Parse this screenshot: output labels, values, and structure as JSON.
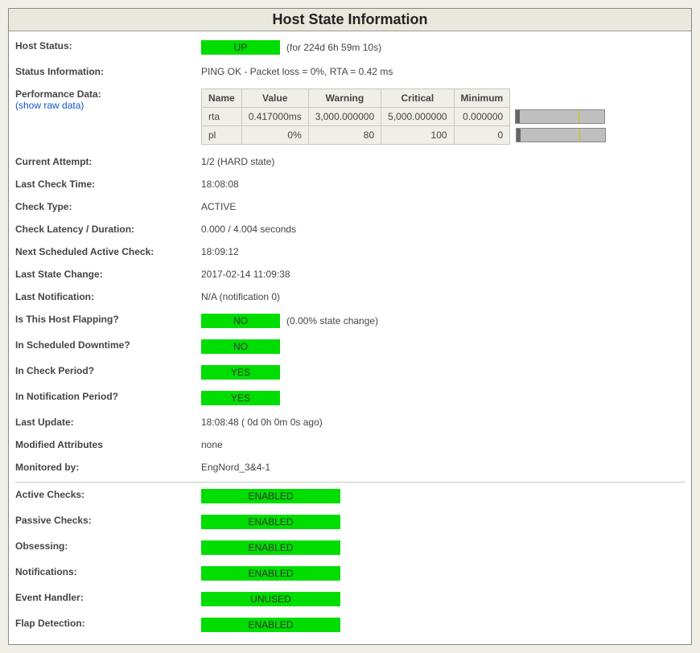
{
  "title": "Host State Information",
  "rows": {
    "host_status": {
      "label": "Host Status:",
      "badge": "UP",
      "trail": "(for 224d 6h 59m 10s)"
    },
    "status_info": {
      "label": "Status Information:",
      "value": "PING OK - Packet loss = 0%, RTA = 0.42 ms"
    },
    "perf": {
      "label": "Performance Data:",
      "link": "(show raw data)",
      "headers": {
        "name": "Name",
        "value": "Value",
        "warning": "Warning",
        "critical": "Critical",
        "minimum": "Minimum"
      },
      "r1": {
        "name": "rta",
        "value": "0.417000ms",
        "warning": "3,000.000000",
        "critical": "5,000.000000",
        "minimum": "0.000000"
      },
      "r2": {
        "name": "pl",
        "value": "0%",
        "warning": "80",
        "critical": "100",
        "minimum": "0"
      }
    },
    "current_attempt": {
      "label": "Current Attempt:",
      "value": "1/2  (HARD state)"
    },
    "last_check": {
      "label": "Last Check Time:",
      "value": "18:08:08"
    },
    "check_type": {
      "label": "Check Type:",
      "value": "ACTIVE"
    },
    "latency": {
      "label": "Check Latency / Duration:",
      "value": "0.000  /  4.004 seconds"
    },
    "next_check": {
      "label": "Next Scheduled Active Check:",
      "value": "18:09:12"
    },
    "last_change": {
      "label": "Last State Change:",
      "value": "2017-02-14 11:09:38"
    },
    "last_notif": {
      "label": "Last Notification:",
      "value": "N/A  (notification 0)"
    },
    "flapping": {
      "label": "Is This Host Flapping?",
      "badge": "NO",
      "trail": "(0.00% state change)"
    },
    "downtime": {
      "label": "In Scheduled Downtime?",
      "badge": "NO"
    },
    "check_period": {
      "label": "In Check Period?",
      "badge": "YES"
    },
    "notif_period": {
      "label": "In Notification Period?",
      "badge": "YES"
    },
    "last_update": {
      "label": "Last Update:",
      "value": "18:08:48  ( 0d 0h 0m 0s ago)"
    },
    "modified": {
      "label": "Modified Attributes",
      "value": "none"
    },
    "monitored": {
      "label": "Monitored by:",
      "value": "EngNord_3&4-1"
    },
    "active_checks": {
      "label": "Active Checks:",
      "badge": "ENABLED"
    },
    "passive_checks": {
      "label": "Passive Checks:",
      "badge": "ENABLED"
    },
    "obsessing": {
      "label": "Obsessing:",
      "badge": "ENABLED"
    },
    "notifications": {
      "label": "Notifications:",
      "badge": "ENABLED"
    },
    "event_handler": {
      "label": "Event Handler:",
      "badge": "UNUSED"
    },
    "flap_detect": {
      "label": "Flap Detection:",
      "badge": "ENABLED"
    }
  }
}
